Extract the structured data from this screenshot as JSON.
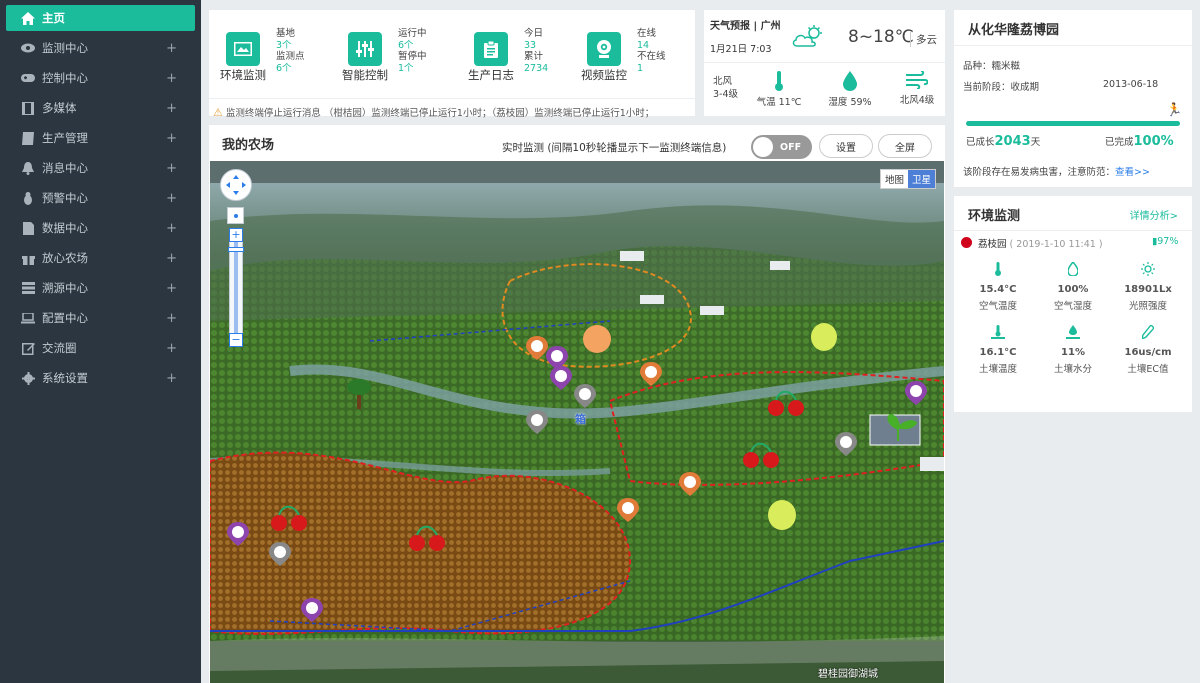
{
  "sidebar": {
    "items": [
      {
        "label": "主页",
        "icon": "home-icon",
        "active": true
      },
      {
        "label": "监测中心",
        "icon": "eye-icon"
      },
      {
        "label": "控制中心",
        "icon": "gamepad-icon"
      },
      {
        "label": "多媒体",
        "icon": "film-icon"
      },
      {
        "label": "生产管理",
        "icon": "book-icon"
      },
      {
        "label": "消息中心",
        "icon": "bell-icon"
      },
      {
        "label": "预警中心",
        "icon": "bug-icon"
      },
      {
        "label": "数据中心",
        "icon": "file-icon"
      },
      {
        "label": "放心农场",
        "icon": "gift-icon"
      },
      {
        "label": "溯源中心",
        "icon": "list-icon"
      },
      {
        "label": "配置中心",
        "icon": "laptop-icon"
      },
      {
        "label": "交流圈",
        "icon": "edit-icon"
      },
      {
        "label": "系统设置",
        "icon": "gear-icon"
      }
    ]
  },
  "stats": {
    "env": {
      "label": "环境监测",
      "k1": "基地",
      "v1": "3个",
      "k2": "监测点",
      "v2": "6个"
    },
    "ctrl": {
      "label": "智能控制",
      "k1": "运行中",
      "v1": "6个",
      "k2": "暂停中",
      "v2": "1个"
    },
    "log": {
      "label": "生产日志",
      "k1": "今日",
      "v1": "33",
      "k2": "累计",
      "v2": "2734"
    },
    "video": {
      "label": "视频监控",
      "k1": "在线",
      "v1": "14",
      "k2": "不在线",
      "v2": "1"
    },
    "ticker": "监测终端停止运行消息 （柑桔园）监测终端已停止运行1小时；（荔枝园）监测终端已停止运行1小时；"
  },
  "weather": {
    "title": "天气预报 | 广州",
    "date": "1月21日 7:03",
    "temp": "8~18℃",
    "desc": "多云",
    "wind": "北风",
    "wind_level": "3-4级",
    "air_temp": "气温 11℃",
    "humidity": "湿度 59%",
    "wind2": "北风4级"
  },
  "farm": {
    "title": "我的农场",
    "realtime": "实时监测 (间隔10秒轮播显示下一监测终端信息)",
    "toggle": "OFF",
    "settings": "设置",
    "fullscreen": "全屏",
    "map_type_map": "地图",
    "map_type_sat": "卫星",
    "map_label": "碧桂园御湖城",
    "map_label2": "箱"
  },
  "garden": {
    "title": "从化华隆荔博园",
    "variety": "品种：糯米糍",
    "stage_label": "当前阶段：收成期",
    "stage_date": "2013-06-18",
    "progress": 1.0,
    "grown_prefix": "已成长",
    "grown_days": "2043",
    "grown_suffix": "天",
    "done_prefix": "已完成",
    "done_pct": "100%",
    "pest_note": "该阶段存在易发病虫害，注意防范：",
    "pest_link": "查看>>"
  },
  "env_monitor": {
    "title": "环境监测",
    "detail_link": "详情分析>",
    "site": "荔枝园",
    "site_time": "( 2019-1-10 11:41 )",
    "battery": "97%",
    "cells": [
      {
        "value": "15.4°C",
        "label": "空气温度",
        "icon": "thermometer-icon"
      },
      {
        "value": "100%",
        "label": "空气湿度",
        "icon": "droplet-icon"
      },
      {
        "value": "18901Lx",
        "label": "光照强度",
        "icon": "sun-icon"
      },
      {
        "value": "16.1°C",
        "label": "土壤温度",
        "icon": "soil-temp-icon"
      },
      {
        "value": "11%",
        "label": "土壤水分",
        "icon": "soil-moisture-icon"
      },
      {
        "value": "16us/cm",
        "label": "土壤EC值",
        "icon": "pen-icon"
      }
    ]
  },
  "colors": {
    "accent": "#1abc9c",
    "sidebar": "#2b3640",
    "active": "#1abc9c"
  }
}
